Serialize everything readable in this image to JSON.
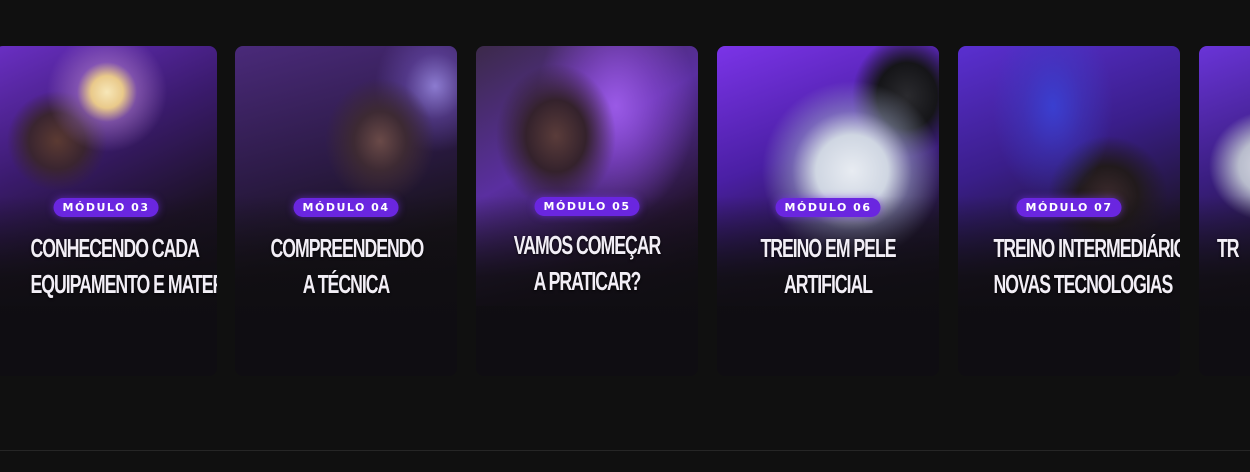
{
  "modules": [
    {
      "badge": "MÓDULO 03",
      "title_line1": "CONHECENDO CADA",
      "title_line2": "EQUIPAMENTO E MATERIAIS"
    },
    {
      "badge": "MÓDULO 04",
      "title_line1": "COMPREENDENDO",
      "title_line2": "A TÉCNICA"
    },
    {
      "badge": "MÓDULO 05",
      "title_line1": "VAMOS COMEÇAR",
      "title_line2": "A PRATICAR?"
    },
    {
      "badge": "MÓDULO 06",
      "title_line1": "TREINO EM PELE",
      "title_line2": "ARTIFICIAL"
    },
    {
      "badge": "MÓDULO 07",
      "title_line1": "TREINO INTERMEDIÁRIO E",
      "title_line2": "NOVAS TECNOLOGIAS"
    },
    {
      "badge": "",
      "title_line1": "TR",
      "title_line2": ""
    }
  ],
  "colors": {
    "background": "#101010",
    "badge": "#6a26e0",
    "accent_purple": "#7b34e8"
  }
}
